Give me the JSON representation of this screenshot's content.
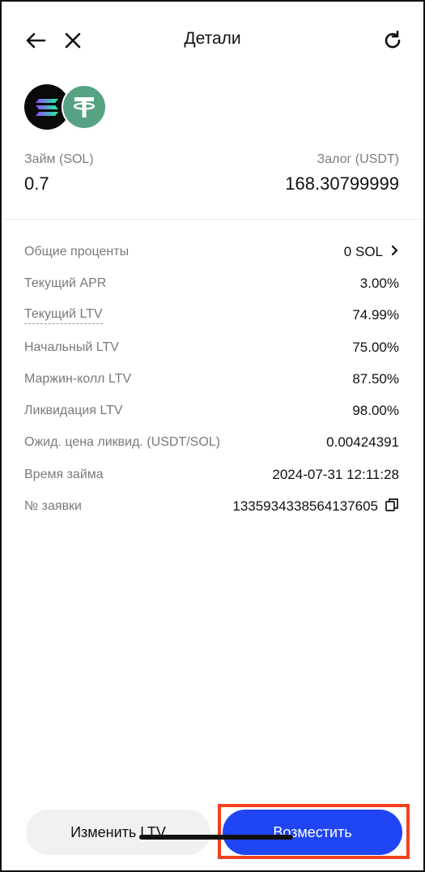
{
  "header": {
    "title": "Детали",
    "back_icon": "arrow-left-icon",
    "close_icon": "close-icon",
    "refresh_icon": "refresh-icon"
  },
  "coins": {
    "sol_icon": "solana-icon",
    "usdt_icon": "tether-icon"
  },
  "summary": {
    "loan_label": "Займ (SOL)",
    "loan_value": "0.7",
    "collateral_label": "Залог (USDT)",
    "collateral_value": "168.30799999"
  },
  "details": [
    {
      "label": "Общие проценты",
      "value": "0 SOL"
    },
    {
      "label": "Текущий APR",
      "value": "3.00%"
    },
    {
      "label": "Текущий LTV",
      "value": "74.99%"
    },
    {
      "label": "Начальный LTV",
      "value": "75.00%"
    },
    {
      "label": "Маржин-колл LTV",
      "value": "87.50%"
    },
    {
      "label": "Ликвидация LTV",
      "value": "98.00%"
    },
    {
      "label": "Ожид. цена ликвид. (USDT/SOL)",
      "value": "0.00424391"
    },
    {
      "label": "Время займа",
      "value": "2024-07-31 12:11:28"
    },
    {
      "label": "№ заявки",
      "value": "1335934338564137605"
    }
  ],
  "buttons": {
    "change_ltv": "Изменить LTV",
    "repay": "Возместить"
  },
  "colors": {
    "primary": "#1f45f5",
    "highlight": "#f2411d",
    "usdt": "#56a383"
  }
}
